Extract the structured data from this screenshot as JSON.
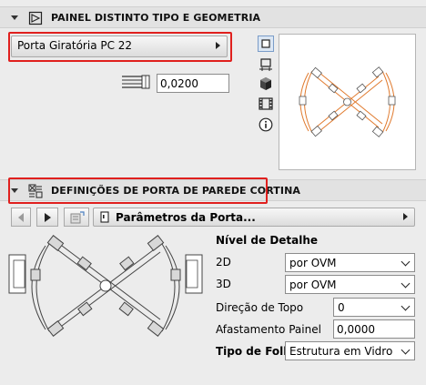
{
  "section1": {
    "title": "PAINEL DISTINTO TIPO E GEOMETRIA",
    "panel_dropdown": "Porta Giratória PC 22",
    "offset_value": "0,0200",
    "side_icons": [
      "square-icon",
      "floor-plan-icon",
      "cube-icon",
      "film-icon",
      "info-icon"
    ]
  },
  "section2": {
    "title": "DEFINIÇÕES DE PORTA DE PAREDE CORTINA",
    "page_dropdown": "Parâmetros da Porta...",
    "detail_heading": "Nível de Detalhe",
    "rows": {
      "label_2d": "2D",
      "value_2d": "por OVM",
      "label_3d": "3D",
      "value_3d": "por OVM",
      "label_dir": "Direção de Topo",
      "value_dir": "0",
      "label_offset": "Afastamento Painel",
      "value_offset": "0,0000",
      "label_leaf": "Tipo de Folha",
      "value_leaf": "Estrutura em Vidro"
    }
  },
  "colors": {
    "highlight": "#e0201e",
    "preview_orange": "#e07a2e"
  }
}
